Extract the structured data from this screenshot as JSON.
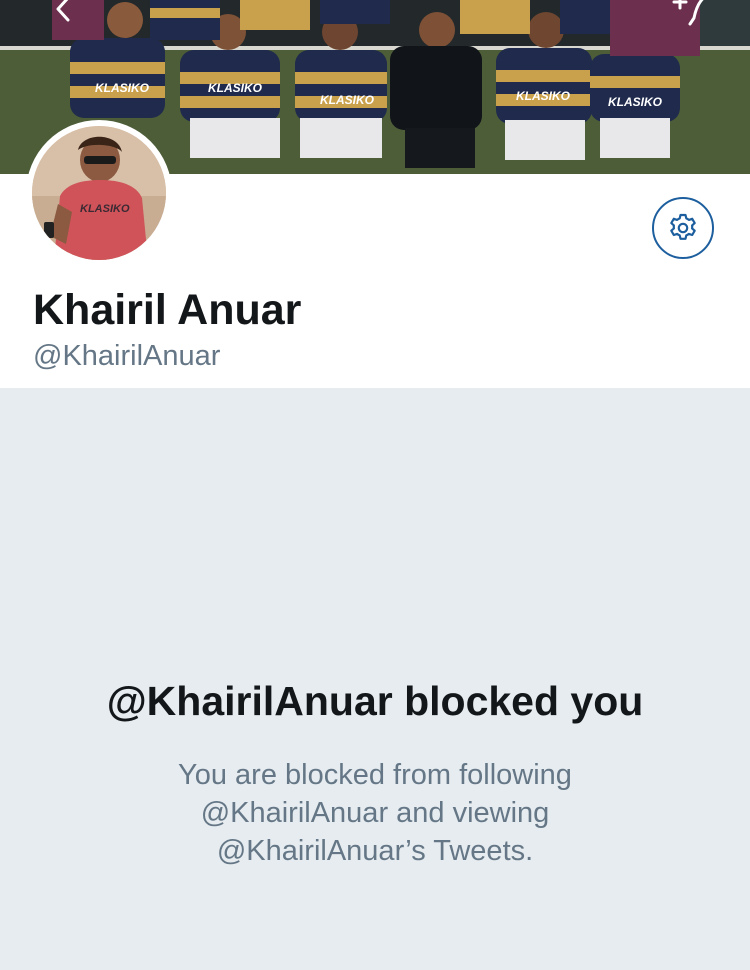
{
  "nav": {
    "back_icon": "chevron-left-icon",
    "compose_icon": "compose-tweet-icon"
  },
  "banner": {
    "jersey_text": "KLASIKO"
  },
  "profile": {
    "display_name": "Khairil Anuar",
    "handle": "@KhairilAnuar",
    "avatar_shirt_text": "KLASIKO",
    "settings_icon": "gear-icon"
  },
  "blocked": {
    "title": "@KhairilAnuar blocked you",
    "line1": "You are blocked from following",
    "line2": "@KhairilAnuar and viewing",
    "line3": "@KhairilAnuar’s Tweets."
  },
  "colors": {
    "accent": "#1d5f9e",
    "background": "#e6ecf0",
    "text_primary": "#14171a",
    "text_secondary": "#657786"
  }
}
